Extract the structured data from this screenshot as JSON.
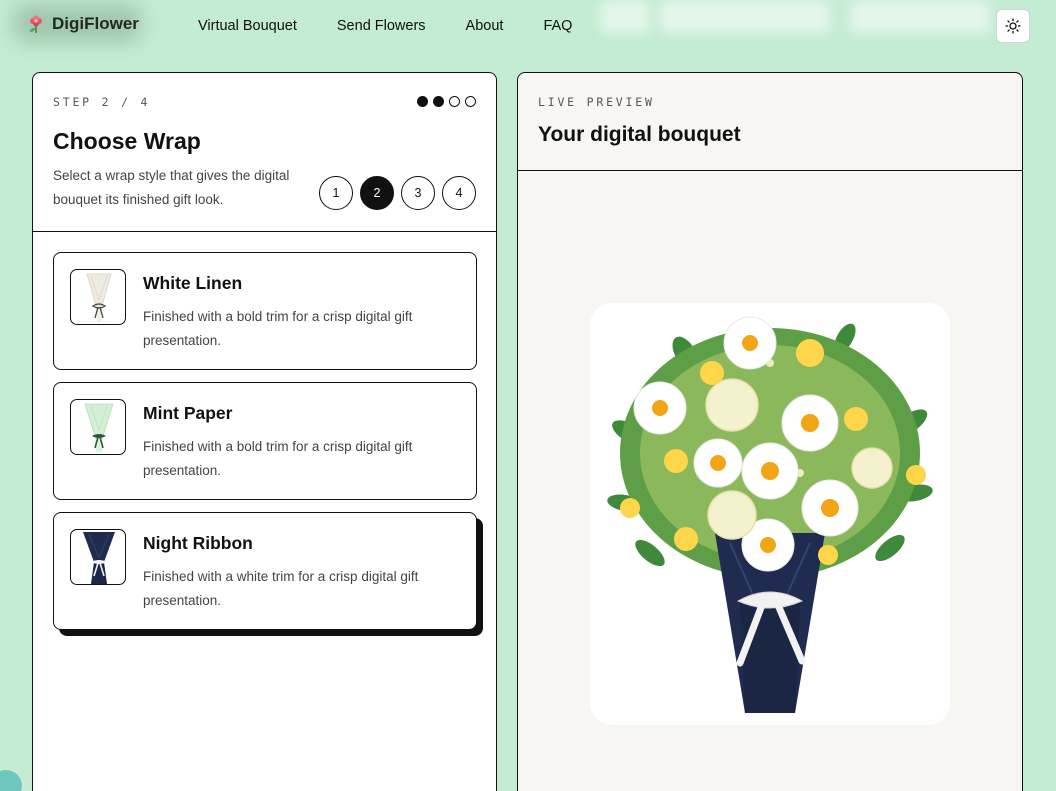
{
  "brand": {
    "name": "DigiFlower"
  },
  "nav": {
    "items": [
      "Virtual Bouquet",
      "Send Flowers",
      "About",
      "FAQ"
    ]
  },
  "builder": {
    "step_label": "STEP 2 / 4",
    "title": "Choose Wrap",
    "description": "Select a wrap style that gives the digital bouquet its finished gift look.",
    "progress": {
      "current": 2,
      "total": 4
    },
    "steps": [
      "1",
      "2",
      "3",
      "4"
    ],
    "options": [
      {
        "name": "White Linen",
        "description": "Finished with a bold trim for a crisp digital gift presentation.",
        "selected": false,
        "wrap_color": "#eeeadf",
        "ribbon_color": "#444444"
      },
      {
        "name": "Mint Paper",
        "description": "Finished with a bold trim for a crisp digital gift presentation.",
        "selected": false,
        "wrap_color": "#cdeccf",
        "ribbon_color": "#2f5a3a"
      },
      {
        "name": "Night Ribbon",
        "description": "Finished with a white trim for a crisp digital gift presentation.",
        "selected": true,
        "wrap_color": "#1f2b4f",
        "ribbon_color": "#ffffff"
      }
    ]
  },
  "preview": {
    "label": "LIVE PREVIEW",
    "title": "Your digital bouquet"
  },
  "colors": {
    "background": "#c3ecd2",
    "accent": "#111111"
  }
}
